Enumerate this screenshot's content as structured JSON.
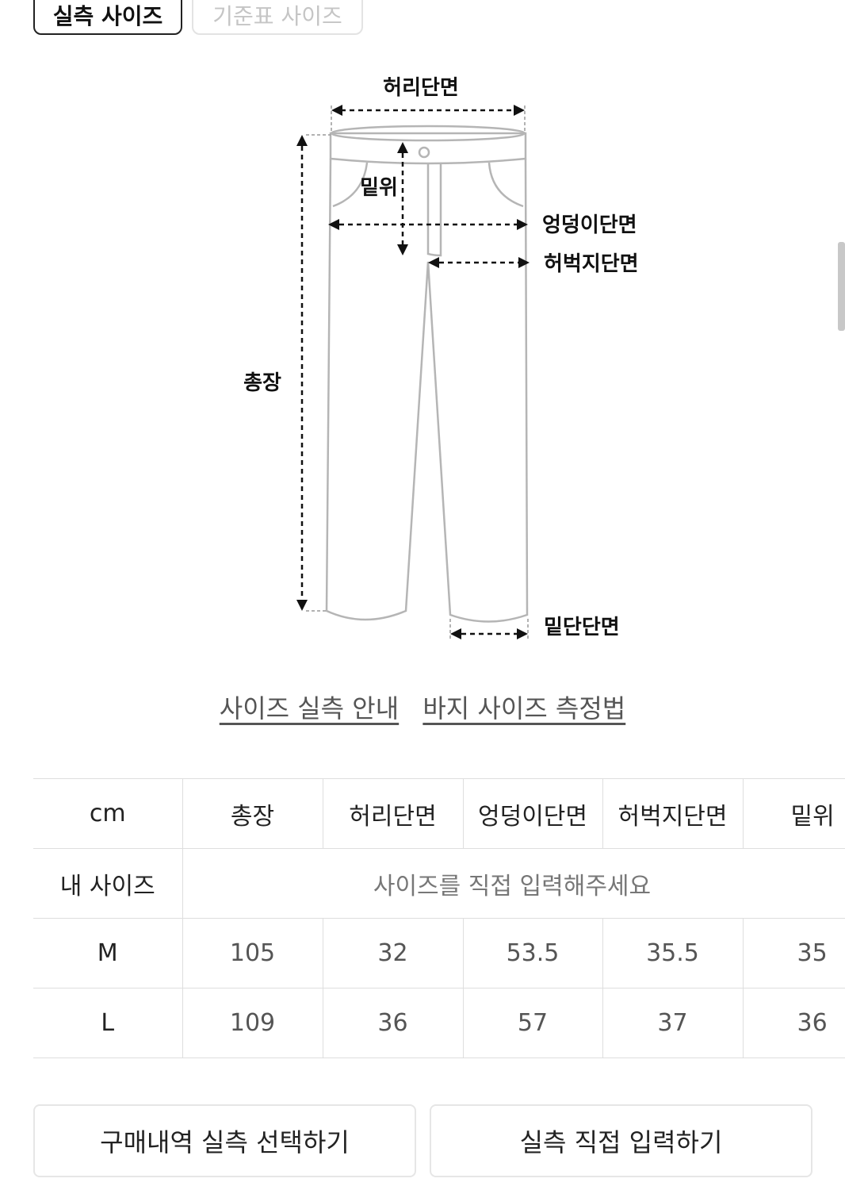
{
  "tabs": {
    "actual_size": "실측 사이즈",
    "standard_size": "기준표 사이즈"
  },
  "diagram": {
    "waist": "허리단면",
    "rise": "밑위",
    "hip": "엉덩이단면",
    "thigh": "허벅지단면",
    "length": "총장",
    "hem": "밑단단면"
  },
  "links": {
    "size_guide": "사이즈 실측 안내",
    "measure_method": "바지 사이즈 측정법"
  },
  "table": {
    "headers": [
      "cm",
      "총장",
      "허리단면",
      "엉덩이단면",
      "허벅지단면",
      "밑위"
    ],
    "my_size_label": "내 사이즈",
    "my_size_hint": "사이즈를 직접 입력해주세요",
    "rows": [
      {
        "size": "M",
        "values": [
          "105",
          "32",
          "53.5",
          "35.5",
          "35"
        ]
      },
      {
        "size": "L",
        "values": [
          "109",
          "36",
          "57",
          "37",
          "36"
        ]
      }
    ]
  },
  "buttons": {
    "purchase_history": "구매내역 실측 선택하기",
    "direct_input": "실측 직접 입력하기"
  }
}
